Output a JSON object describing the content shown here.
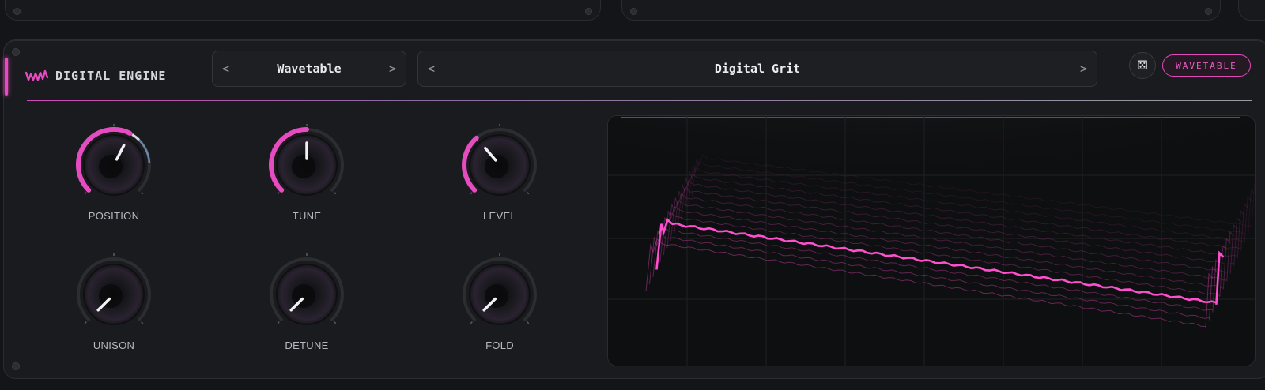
{
  "engine": {
    "title": "DIGITAL ENGINE",
    "icon": "waveform-icon",
    "accent_color": "#e64bc0"
  },
  "type_selector": {
    "prev_label": "<",
    "value": "Wavetable",
    "next_label": ">"
  },
  "preset_selector": {
    "prev_label": "<",
    "value": "Digital Grit",
    "next_label": ">"
  },
  "random_button": {
    "icon": "dice-icon",
    "glyph": "⚄"
  },
  "mode_badge": {
    "label": "WAVETABLE"
  },
  "knobs": [
    {
      "id": "position",
      "label": "POSITION",
      "value": 0.6,
      "accent": "#e64bc0",
      "modulation": 0.22
    },
    {
      "id": "tune",
      "label": "TUNE",
      "value": 0.5,
      "accent": "#e64bc0"
    },
    {
      "id": "level",
      "label": "LEVEL",
      "value": 0.35,
      "accent": "#e64bc0"
    },
    {
      "id": "unison",
      "label": "UNISON",
      "value": 0.0
    },
    {
      "id": "detune",
      "label": "DETUNE",
      "value": 0.0
    },
    {
      "id": "fold",
      "label": "FOLD",
      "value": 0.0
    }
  ],
  "wavetable_display": {
    "frames": 14,
    "highlight_color": "#ff4fcf"
  }
}
